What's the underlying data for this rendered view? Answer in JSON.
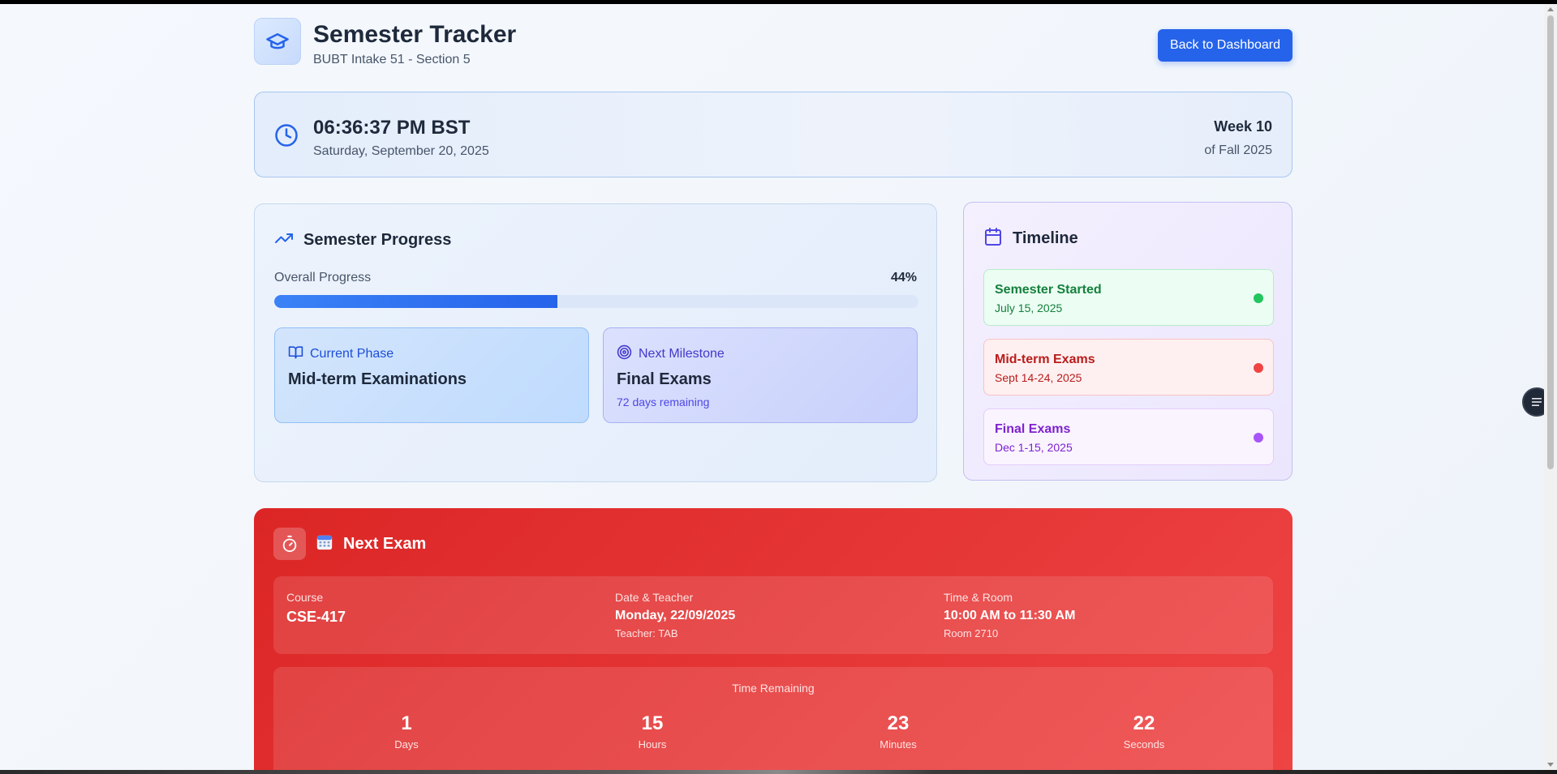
{
  "header": {
    "title": "Semester Tracker",
    "subtitle": "BUBT Intake 51 - Section 5",
    "back_button": "Back to Dashboard"
  },
  "clock": {
    "time": "06:36:37 PM BST",
    "date": "Saturday, September 20, 2025",
    "week": "Week 10",
    "term": "of Fall 2025"
  },
  "progress": {
    "heading": "Semester Progress",
    "overall_label": "Overall Progress",
    "percent_text": "44%",
    "percent_value": 44,
    "current_phase": {
      "label": "Current Phase",
      "title": "Mid-term Examinations"
    },
    "next_milestone": {
      "label": "Next Milestone",
      "title": "Final Exams",
      "note": "72 days remaining"
    }
  },
  "timeline": {
    "heading": "Timeline",
    "items": [
      {
        "title": "Semester Started",
        "date": "July 15, 2025",
        "color": "#22c55e"
      },
      {
        "title": "Mid-term Exams",
        "date": "Sept 14-24, 2025",
        "color": "#ef4444"
      },
      {
        "title": "Final Exams",
        "date": "Dec 1-15, 2025",
        "color": "#a855f7"
      }
    ]
  },
  "next_exam": {
    "heading": "Next Exam",
    "course_label": "Course",
    "course": "CSE-417",
    "date_label": "Date & Teacher",
    "date": "Monday, 22/09/2025",
    "teacher": "Teacher: TAB",
    "time_label": "Time & Room",
    "time": "10:00 AM to 11:30 AM",
    "room": "Room 2710",
    "countdown_title": "Time Remaining",
    "countdown": [
      {
        "value": "1",
        "unit": "Days"
      },
      {
        "value": "15",
        "unit": "Hours"
      },
      {
        "value": "23",
        "unit": "Minutes"
      },
      {
        "value": "22",
        "unit": "Seconds"
      }
    ]
  },
  "colors": {
    "primary": "#2563eb",
    "exam_red": "#dc2626",
    "accent_purple": "#4f46e5"
  }
}
